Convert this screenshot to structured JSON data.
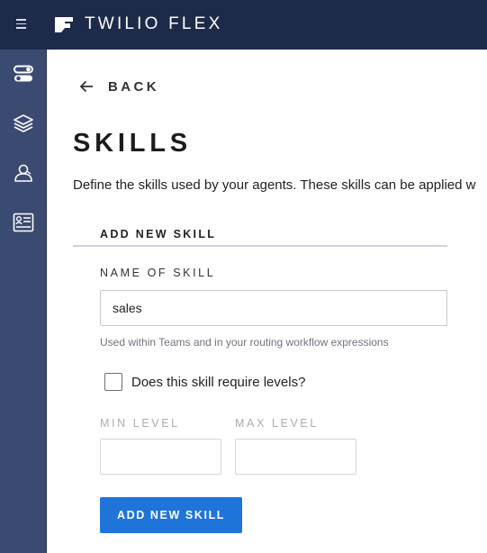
{
  "topbar": {
    "brand": "TWILIO FLEX",
    "menu_icon": "hamburger-menu-icon",
    "logo_icon": "twilio-flex-logo-icon"
  },
  "sidebar": {
    "items": [
      {
        "name": "toggles-icon"
      },
      {
        "name": "layers-icon"
      },
      {
        "name": "agent-icon"
      },
      {
        "name": "list-card-icon"
      }
    ]
  },
  "main": {
    "back_label": "BACK",
    "title": "SKILLS",
    "description": "Define the skills used by your agents. These skills can be applied w",
    "section_title": "ADD NEW SKILL",
    "name_label": "NAME OF SKILL",
    "name_value": "sales",
    "hint": "Used within Teams and in your routing workflow expressions",
    "levels_checkbox_label": "Does this skill require levels?",
    "min_level_label": "MIN LEVEL",
    "max_level_label": "MAX LEVEL",
    "min_level_value": "",
    "max_level_value": "",
    "submit_label": "ADD NEW SKILL"
  },
  "colors": {
    "topbar": "#1e2a4a",
    "sidebar": "#3b4a70",
    "primary": "#1f74d9"
  }
}
